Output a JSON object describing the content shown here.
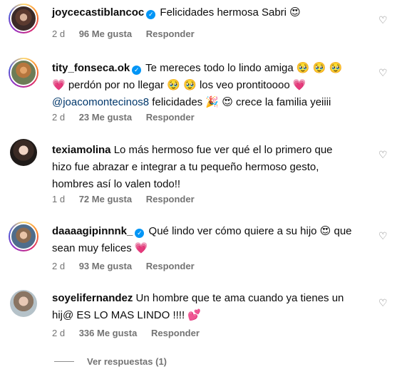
{
  "comments": [
    {
      "username": "joycecastiblancoc",
      "verified": true,
      "text": "Felicidades hermosa Sabri 😍",
      "time": "2 d",
      "likes": "96 Me gusta",
      "reply_label": "Responder"
    },
    {
      "username": "tity_fonseca.ok",
      "verified": true,
      "text_parts": [
        "Te mereces todo lo lindo amiga 🥹 🥹 🥹",
        "💗 perdón por no llegar 🥹 🥹  los veo prontitoooo 💗",
        "@joacomontecinos8",
        " felicidades 🎉  😍  crece la familia yeiiii"
      ],
      "time": "2 d",
      "likes": "23 Me gusta",
      "reply_label": "Responder"
    },
    {
      "username": "texiamolina",
      "verified": false,
      "text_lines": [
        "Lo más hermoso fue ver qué el lo primero que",
        "hizo fue abrazar e integrar a tu pequeño hermoso gesto,",
        "hombres así lo valen todo!!"
      ],
      "time": "1 d",
      "likes": "72 Me gusta",
      "reply_label": "Responder"
    },
    {
      "username": "daaaagipinnnk_",
      "verified": true,
      "text_lines": [
        "Qué lindo ver cómo quiere a su hijo 😍 que",
        "sean muy felices 💗"
      ],
      "time": "2 d",
      "likes": "93 Me gusta",
      "reply_label": "Responder"
    },
    {
      "username": "soyelifernandez",
      "verified": false,
      "text_lines": [
        "Un hombre que te ama cuando ya tienes un",
        "hij@ ES LO MAS LINDO !!!! 💕"
      ],
      "time": "2 d",
      "likes": "336 Me gusta",
      "reply_label": "Responder"
    }
  ],
  "view_replies": "Ver respuestas (1)",
  "icons": {
    "like": "heart-outline-icon",
    "verified": "verified-badge-icon"
  },
  "colors": {
    "text": "#0c0c0c",
    "secondary": "#737373",
    "mention": "#00376b",
    "verified": "#0095f6"
  }
}
